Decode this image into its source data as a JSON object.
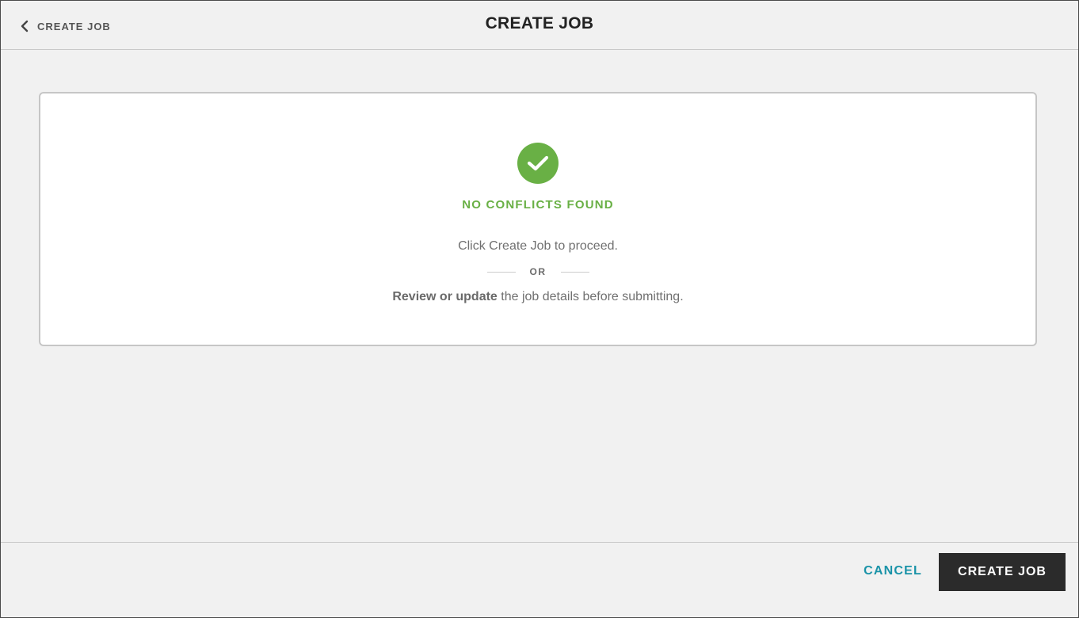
{
  "header": {
    "back_label": "CREATE JOB",
    "title": "CREATE JOB",
    "back_icon": "chevron-left-icon"
  },
  "result": {
    "icon": "check-circle-icon",
    "title": "NO CONFLICTS FOUND",
    "instruction": "Click Create Job to proceed.",
    "separator": "OR",
    "review_bold": "Review or update",
    "review_rest": " the job details before submitting.",
    "accent_color": "#69b045"
  },
  "footer": {
    "cancel_label": "CANCEL",
    "create_label": "CREATE JOB",
    "cancel_color": "#1a93a8",
    "create_bg": "#2b2b2b"
  }
}
